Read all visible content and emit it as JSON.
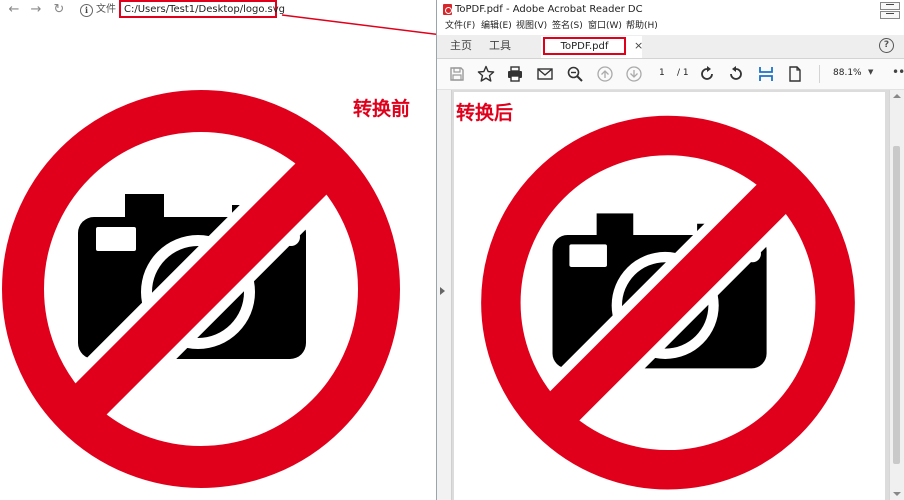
{
  "browser": {
    "back_icon": "arrow-left-icon",
    "forward_icon": "arrow-right-icon",
    "reload_icon": "reload-icon",
    "info_icon": "info-icon",
    "scheme_label": "文件",
    "url": "C:/Users/Test1/Desktop/logo.svg"
  },
  "captions": {
    "before": "转换前",
    "after": "转换后"
  },
  "acrobat": {
    "title": "ToPDF.pdf - Adobe Acrobat Reader DC",
    "menu": [
      "文件(F)",
      "编辑(E)",
      "视图(V)",
      "签名(S)",
      "窗口(W)",
      "帮助(H)"
    ],
    "tabs": {
      "home": "主页",
      "tools": "工具",
      "document": "ToPDF.pdf",
      "close": "×"
    },
    "help_label": "?",
    "toolbar": {
      "page_current": "1",
      "page_total": "/ 1",
      "zoom": "88.1%",
      "icons": [
        "save-icon",
        "bookmark-star-icon",
        "print-icon",
        "email-icon",
        "zoom-out-icon",
        "page-up-icon",
        "page-down-icon",
        "rotate-clockwise-icon",
        "rotate-counterclockwise-icon",
        "fit-page-icon",
        "page-view-icon"
      ]
    }
  },
  "colors": {
    "accent_red": "#e0001b",
    "sign_black": "#000000"
  }
}
